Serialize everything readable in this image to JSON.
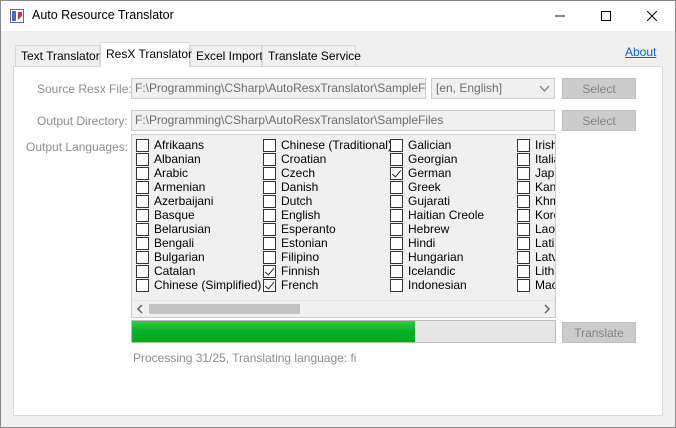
{
  "window": {
    "title": "Auto Resource Translator"
  },
  "tabs": [
    {
      "label": "Text Translator",
      "active": false
    },
    {
      "label": "ResX Translator",
      "active": true
    },
    {
      "label": "Excel Import",
      "active": false
    },
    {
      "label": "Translate Service",
      "active": false
    }
  ],
  "about_link": "About",
  "form": {
    "source_label": "Source Resx File:",
    "source_value": "F:\\Programming\\CSharp\\AutoResxTranslator\\SampleFiles\\Gri",
    "source_language": "[en, English]",
    "source_select_button": "Select",
    "output_dir_label": "Output Directory:",
    "output_dir_value": "F:\\Programming\\CSharp\\AutoResxTranslator\\SampleFiles",
    "output_select_button": "Select",
    "output_languages_label": "Output Languages:"
  },
  "languages": {
    "columns": [
      [
        {
          "name": "Afrikaans",
          "checked": false
        },
        {
          "name": "Albanian",
          "checked": false
        },
        {
          "name": "Arabic",
          "checked": false
        },
        {
          "name": "Armenian",
          "checked": false
        },
        {
          "name": "Azerbaijani",
          "checked": false
        },
        {
          "name": "Basque",
          "checked": false
        },
        {
          "name": "Belarusian",
          "checked": false
        },
        {
          "name": "Bengali",
          "checked": false
        },
        {
          "name": "Bulgarian",
          "checked": false
        },
        {
          "name": "Catalan",
          "checked": false
        },
        {
          "name": "Chinese (Simplified)",
          "checked": false
        }
      ],
      [
        {
          "name": "Chinese (Traditional)",
          "checked": false
        },
        {
          "name": "Croatian",
          "checked": false
        },
        {
          "name": "Czech",
          "checked": false
        },
        {
          "name": "Danish",
          "checked": false
        },
        {
          "name": "Dutch",
          "checked": false
        },
        {
          "name": "English",
          "checked": false
        },
        {
          "name": "Esperanto",
          "checked": false
        },
        {
          "name": "Estonian",
          "checked": false
        },
        {
          "name": "Filipino",
          "checked": false
        },
        {
          "name": "Finnish",
          "checked": true
        },
        {
          "name": "French",
          "checked": true
        }
      ],
      [
        {
          "name": "Galician",
          "checked": false
        },
        {
          "name": "Georgian",
          "checked": false
        },
        {
          "name": "German",
          "checked": true
        },
        {
          "name": "Greek",
          "checked": false
        },
        {
          "name": "Gujarati",
          "checked": false
        },
        {
          "name": "Haitian Creole",
          "checked": false
        },
        {
          "name": "Hebrew",
          "checked": false
        },
        {
          "name": "Hindi",
          "checked": false
        },
        {
          "name": "Hungarian",
          "checked": false
        },
        {
          "name": "Icelandic",
          "checked": false
        },
        {
          "name": "Indonesian",
          "checked": false
        }
      ],
      [
        {
          "name": "Irish",
          "checked": false
        },
        {
          "name": "Italian",
          "checked": false
        },
        {
          "name": "Japanese",
          "checked": false
        },
        {
          "name": "Kannada",
          "checked": false
        },
        {
          "name": "Khmer",
          "checked": false
        },
        {
          "name": "Korean",
          "checked": false
        },
        {
          "name": "Lao",
          "checked": false
        },
        {
          "name": "Latin",
          "checked": false
        },
        {
          "name": "Latvian",
          "checked": false
        },
        {
          "name": "Lithuanian",
          "checked": false
        },
        {
          "name": "Macedonian",
          "checked": false
        }
      ]
    ]
  },
  "progress": {
    "fraction": 0.67
  },
  "translate_button": "Translate",
  "status_text": "Processing 31/25, Translating language: fi",
  "colors": {
    "progress_green": "#06b025",
    "link_blue": "#0066cc",
    "disabled_text": "#8c8c8c"
  }
}
